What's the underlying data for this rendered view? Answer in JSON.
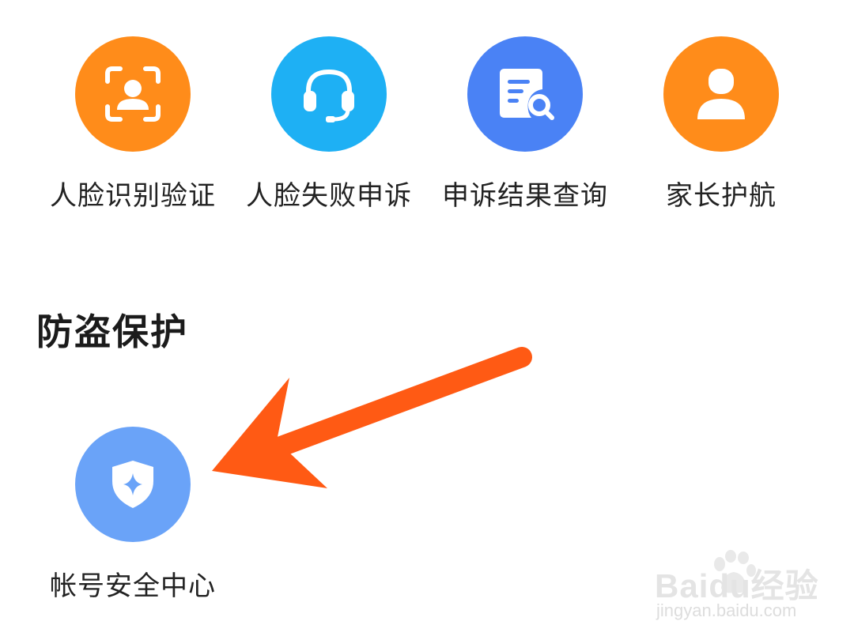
{
  "top_row": {
    "items": [
      {
        "label": "人脸识别验证",
        "icon": "face-scan-icon",
        "color": "#FF8C1A"
      },
      {
        "label": "人脸失败申诉",
        "icon": "headset-icon",
        "color": "#1EB0F4"
      },
      {
        "label": "申诉结果查询",
        "icon": "document-search-icon",
        "color": "#4A82F5"
      },
      {
        "label": "家长护航",
        "icon": "person-icon",
        "color": "#FF8C1A"
      }
    ]
  },
  "section": {
    "title": "防盗保护",
    "items": [
      {
        "label": "帐号安全中心",
        "icon": "shield-star-icon",
        "color": "#6AA3F8"
      }
    ]
  },
  "annotation": {
    "arrow_color": "#FF5A14"
  },
  "watermark": {
    "main": "Baidu经验",
    "sub": "jingyan.baidu.com"
  }
}
